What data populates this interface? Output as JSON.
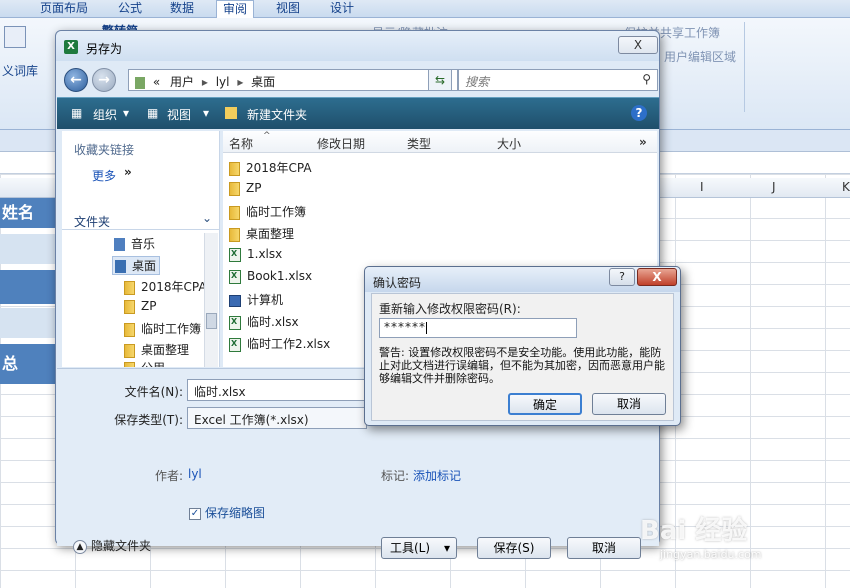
{
  "excel": {
    "tabs": [
      "页面布局",
      "公式",
      "数据",
      "审阅",
      "视图",
      "设计"
    ],
    "ribbon": {
      "custom_dict": "义词库",
      "simplified": "繁转简",
      "show_comments": "显示/隐藏批注",
      "protect_share": "保护并共享工作簿",
      "allow_edit": "用户编辑区域"
    },
    "columns": [
      "I",
      "J",
      "K"
    ],
    "cells": [
      "姓名",
      "总"
    ]
  },
  "save_dialog": {
    "title": "另存为",
    "close_label": "X",
    "breadcrumb": [
      "«",
      "用户",
      "lyl",
      "桌面"
    ],
    "search_placeholder": "搜索",
    "toolbar": {
      "organize": "组织",
      "view": "视图",
      "new_folder": "新建文件夹",
      "help": "?"
    },
    "nav": {
      "favorites": "收藏夹链接",
      "more": "更多",
      "folders": "文件夹",
      "tree": [
        "音乐",
        "桌面",
        "2018年CPA",
        "ZP",
        "临时工作簿",
        "桌面整理",
        "公用"
      ]
    },
    "columns": [
      "名称",
      "修改日期",
      "类型",
      "大小"
    ],
    "files": [
      {
        "name": "2018年CPA",
        "kind": "folder"
      },
      {
        "name": "ZP",
        "kind": "folder"
      },
      {
        "name": "临时工作簿",
        "kind": "folder"
      },
      {
        "name": "桌面整理",
        "kind": "folder"
      },
      {
        "name": "1.xlsx",
        "kind": "excel"
      },
      {
        "name": "Book1.xlsx",
        "kind": "excel"
      },
      {
        "name": "计算机",
        "kind": "computer"
      },
      {
        "name": "临时.xlsx",
        "kind": "excel"
      },
      {
        "name": "临时工作2.xlsx",
        "kind": "excel"
      }
    ],
    "filename_label": "文件名(N):",
    "filename_value": "临时.xlsx",
    "filetype_label": "保存类型(T):",
    "filetype_value": "Excel 工作簿(*.xlsx)",
    "author_label": "作者:",
    "author_value": "lyl",
    "tags_label": "标记:",
    "tags_value": "添加标记",
    "thumbnail_label": "保存缩略图",
    "hide_folders": "隐藏文件夹",
    "tools_button": "工具(L)",
    "save_button": "保存(S)",
    "cancel_button": "取消"
  },
  "confirm_dialog": {
    "title": "确认密码",
    "help_label": "?",
    "close_label": "X",
    "prompt": "重新输入修改权限密码(R):",
    "password_value": "******",
    "warning": "警告: 设置修改权限密码不是安全功能。使用此功能，能防止对此文档进行误编辑，但不能为其加密，因而恶意用户能够编辑文件并删除密码。",
    "ok_button": "确定",
    "cancel_button": "取消"
  },
  "watermark": {
    "brand": "Bai 经验",
    "url": "jingyan.baidu.com"
  }
}
